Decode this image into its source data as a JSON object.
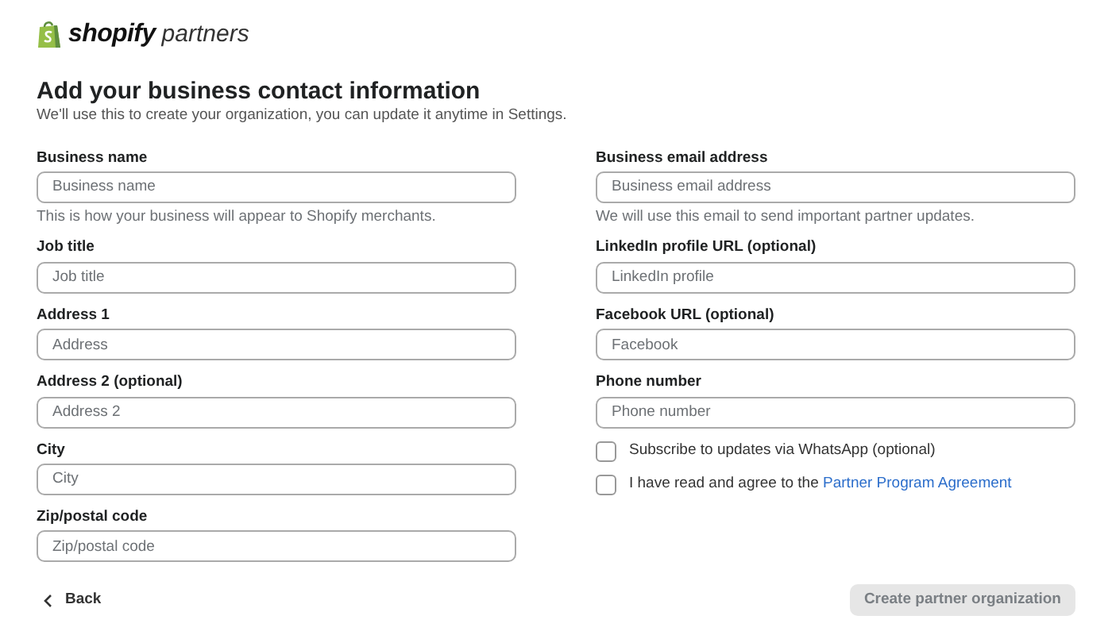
{
  "logo": {
    "brand": "shopify",
    "product": "partners"
  },
  "heading": "Add your business contact information",
  "subtitle": "We'll use this to create your organization, you can update it anytime in Settings.",
  "left_fields": [
    {
      "label": "Business name",
      "placeholder": "Business name",
      "help": "This is how your business will appear to Shopify merchants."
    },
    {
      "label": "Job title",
      "placeholder": "Job title"
    },
    {
      "label": "Address 1",
      "placeholder": "Address"
    },
    {
      "label": "Address 2 (optional)",
      "placeholder": "Address 2"
    },
    {
      "label": "City",
      "placeholder": "City"
    },
    {
      "label": "Zip/postal code",
      "placeholder": "Zip/postal code"
    }
  ],
  "right_fields": [
    {
      "label": "Business email address",
      "placeholder": "Business email address",
      "help": "We will use this email to send important partner updates."
    },
    {
      "label": "LinkedIn profile URL (optional)",
      "placeholder": "LinkedIn profile"
    },
    {
      "label": "Facebook URL (optional)",
      "placeholder": "Facebook"
    },
    {
      "label": "Phone number",
      "placeholder": "Phone number"
    }
  ],
  "checkboxes": [
    {
      "label": "Subscribe to updates via WhatsApp (optional)",
      "checked": false
    },
    {
      "label": "I have read and agree to the",
      "link": "Partner Program Agreement",
      "checked": false
    }
  ],
  "back_button": "Back",
  "submit_button": {
    "label": "Create partner organization",
    "disabled": true
  }
}
